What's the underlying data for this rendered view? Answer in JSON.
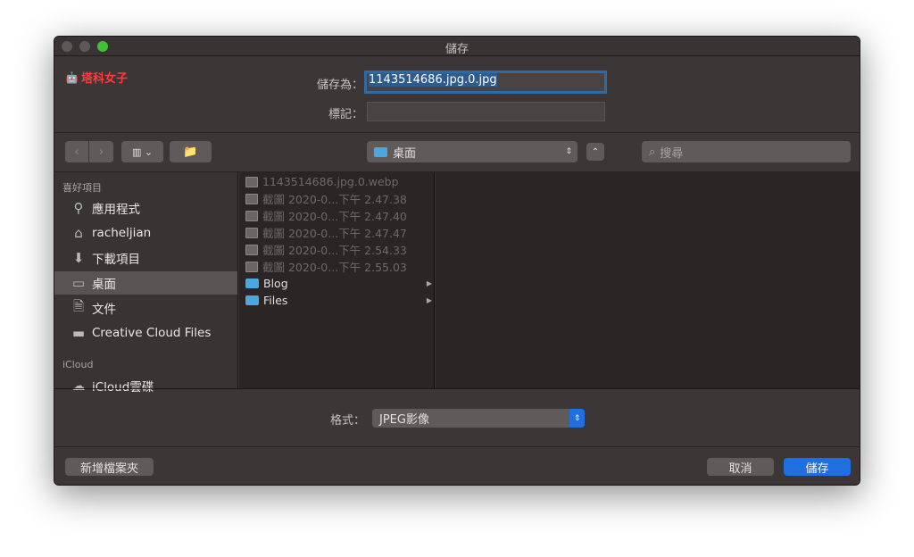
{
  "window": {
    "title": "儲存",
    "traffic_lights": {
      "close": "#5e5859",
      "minimize": "#5e5859",
      "zoom": "#3fc231"
    }
  },
  "watermark": "塔科女子",
  "form": {
    "save_as_label": "儲存為：",
    "save_as_value": "1143514686.jpg.0.jpg",
    "tags_label": "標記：",
    "tags_value": ""
  },
  "toolbar": {
    "back_icon": "chevron-left",
    "forward_icon": "chevron-right",
    "view_icon": "column-view",
    "new_folder_icon": "folder-plus",
    "location": "桌面",
    "search_placeholder": "搜尋"
  },
  "sidebar": {
    "favorites_label": "喜好項目",
    "items": [
      {
        "label": "應用程式",
        "icon": "applications"
      },
      {
        "label": "racheljian",
        "icon": "home"
      },
      {
        "label": "下載項目",
        "icon": "download"
      },
      {
        "label": "桌面",
        "icon": "desktop",
        "selected": true
      },
      {
        "label": "文件",
        "icon": "documents"
      },
      {
        "label": "Creative Cloud Files",
        "icon": "folder"
      }
    ],
    "icloud_label": "iCloud",
    "icloud_items": [
      {
        "label": "iCloud雲碟",
        "icon": "cloud"
      }
    ]
  },
  "files": [
    {
      "name": "1143514686.jpg.0.webp",
      "type": "file",
      "disabled": true
    },
    {
      "name": "截圖 2020-0...下午 2.47.38",
      "type": "image",
      "disabled": true
    },
    {
      "name": "截圖 2020-0...下午 2.47.40",
      "type": "image",
      "disabled": true
    },
    {
      "name": "截圖 2020-0...下午 2.47.47",
      "type": "image",
      "disabled": true
    },
    {
      "name": "截圖 2020-0...下午 2.54.33",
      "type": "image",
      "disabled": true
    },
    {
      "name": "截圖 2020-0...下午 2.55.03",
      "type": "image",
      "disabled": true
    },
    {
      "name": "Blog",
      "type": "folder",
      "disabled": false
    },
    {
      "name": "Files",
      "type": "folder",
      "disabled": false
    }
  ],
  "format": {
    "label": "格式：",
    "value": "JPEG影像"
  },
  "footer": {
    "new_folder": "新增檔案夾",
    "cancel": "取消",
    "save": "儲存",
    "accent": "#1f6fe0"
  }
}
